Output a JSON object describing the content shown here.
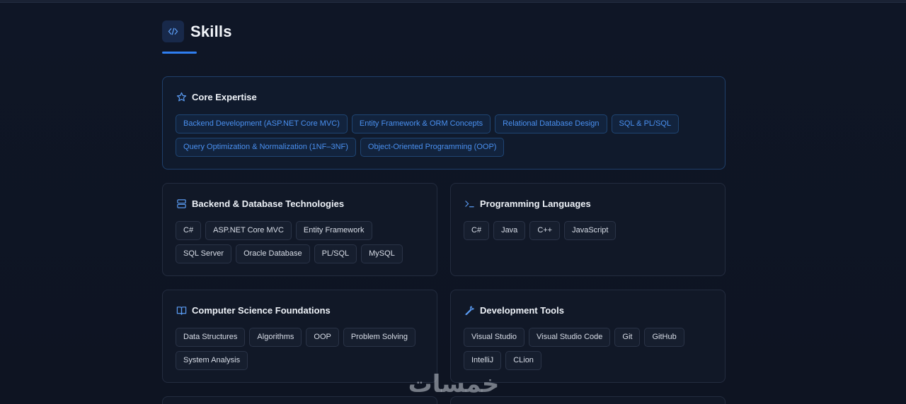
{
  "section": {
    "title": "Skills",
    "icon": "code-icon"
  },
  "colors": {
    "background": "#0f1524",
    "accent": "#2f7ef0",
    "card_border": "#232c3f",
    "featured_border": "#1f3f6a",
    "featured_tag_text": "#4a90f0"
  },
  "core_expertise": {
    "title": "Core Expertise",
    "icon": "star-icon",
    "tags": [
      "Backend Development (ASP.NET Core MVC)",
      "Entity Framework & ORM Concepts",
      "Relational Database Design",
      "SQL & PL/SQL",
      "Query Optimization & Normalization (1NF–3NF)",
      "Object-Oriented Programming (OOP)"
    ]
  },
  "backend_db": {
    "title": "Backend & Database Technologies",
    "icon": "database-icon",
    "tags": [
      "C#",
      "ASP.NET Core MVC",
      "Entity Framework",
      "SQL Server",
      "Oracle Database",
      "PL/SQL",
      "MySQL"
    ]
  },
  "languages": {
    "title": "Programming Languages",
    "icon": "terminal-icon",
    "tags": [
      "C#",
      "Java",
      "C++",
      "JavaScript"
    ]
  },
  "cs_foundations": {
    "title": "Computer Science Foundations",
    "icon": "book-icon",
    "tags": [
      "Data Structures",
      "Algorithms",
      "OOP",
      "Problem Solving",
      "System Analysis"
    ]
  },
  "dev_tools": {
    "title": "Development Tools",
    "icon": "wrench-icon",
    "tags": [
      "Visual Studio",
      "Visual Studio Code",
      "Git",
      "GitHub",
      "IntelliJ",
      "CLion"
    ]
  },
  "watermark": {
    "text": "خمسات"
  }
}
